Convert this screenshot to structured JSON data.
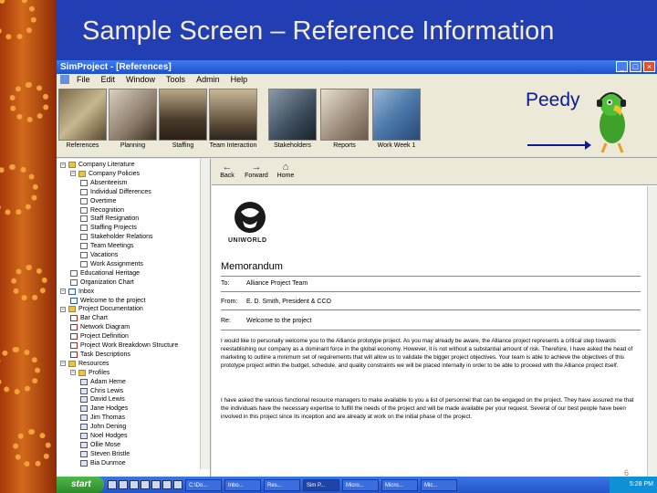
{
  "slide": {
    "title": "Sample Screen – Reference Information",
    "page_number": "6"
  },
  "window": {
    "title": "SimProject - [References]",
    "controls": [
      "_",
      "□",
      "×"
    ],
    "menu": [
      "File",
      "Edit",
      "Window",
      "Tools",
      "Admin",
      "Help"
    ]
  },
  "toolbar": {
    "tools": [
      "References",
      "Planning",
      "Staffing",
      "Team Interaction",
      "Stakeholders",
      "Reports",
      "Work Week 1"
    ]
  },
  "agent": {
    "label": "Peedy"
  },
  "tree": {
    "items": [
      "Company Literature",
      "Company Policies",
      "Absenteeism",
      "Individual Differences",
      "Overtime",
      "Recognition",
      "Staff Resignation",
      "Staffing Projects",
      "Stakeholder Relations",
      "Team Meetings",
      "Vacations",
      "Work Assignments",
      "Educational Heritage",
      "Organization Chart",
      "Inbox",
      "Welcome to the project",
      "Project Documentation",
      "Bar Chart",
      "Network Diagram",
      "Project Definition",
      "Project Work Breakdown Structure",
      "Task Descriptions",
      "Resources",
      "Profiles",
      "Adam Heme",
      "Chris Lewis",
      "David Lewis",
      "Jane Hodges",
      "Jim Thomas",
      "John Dening",
      "Noel Hodges",
      "Ollie Mose",
      "Steven Bristle",
      "Bia Dunmoe"
    ]
  },
  "nav": {
    "back": "Back",
    "forward": "Forward",
    "home": "Home"
  },
  "memo": {
    "company": "UNIWORLD",
    "title": "Memorandum",
    "to_key": "To:",
    "to": "Alliance Project Team",
    "from_key": "From:",
    "from": "E. D. Smith, President & CCO",
    "re_key": "Re:",
    "re": "Welcome to the project",
    "para1": "I would like to personally welcome you to the Alliance prototype project. As you may already be aware, the Alliance project represents a critical step towards reestablishing our company as a dominant force in the global economy. However, it is not without a substantial amount of risk. Therefore, I have asked the head of marketing to outline a minimum set of requirements that will allow us to validate the bigger project objectives. Your team is able to achieve the objectives of this prototype project within the budget, schedule, and quality constraints we will be placed internally in order to be able to proceed with the Alliance project itself.",
    "para2": "I have asked the various functional resource managers to make available to you a list of personnel that can be engaged on the project. They have assured me that the individuals have the necessary expertise to fulfill the needs of the project and will be made available per your request. Several of our best people have been involved in this project since its inception and are already at work on the initial phase of the project."
  },
  "taskbar": {
    "start": "start",
    "tasks": [
      "C:\\Do...",
      "Inbo...",
      "Res...",
      "Sim P...",
      "Micro...",
      "Micro...",
      "Mic..."
    ],
    "clock": "5:28 PM"
  },
  "colors": {
    "slide_bg": "#1c3aa8",
    "title_text": "#f5ecd0",
    "window_bg": "#ece9d8",
    "peedy_text": "#0a1a9a"
  }
}
